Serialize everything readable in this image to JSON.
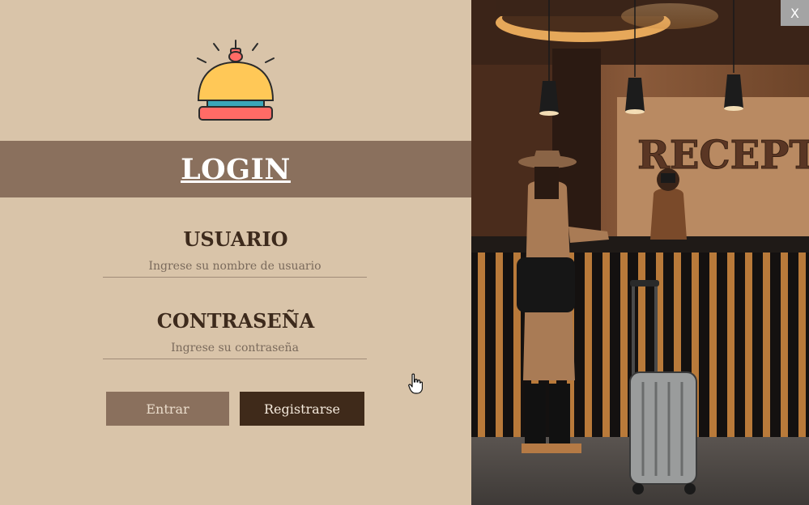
{
  "login": {
    "title": "LOGIN",
    "usuario_label": "USUARIO",
    "usuario_placeholder": "Ingrese su nombre de usuario",
    "contrasena_label": "CONTRASEÑA",
    "contrasena_placeholder": "Ingrese su contraseña",
    "entrar_label": "Entrar",
    "registrarse_label": "Registrarse"
  },
  "photo": {
    "sign_text": "RECEPT"
  },
  "window": {
    "close_label": "X"
  },
  "icons": {
    "bell": "reception-bell-icon",
    "cursor": "hand-pointer-icon"
  },
  "colors": {
    "background": "#d9c4a9",
    "banner": "#8a705d",
    "text_dark": "#3d2a1c",
    "button_light": "#8a705d",
    "button_dark": "#3f2a1a"
  }
}
